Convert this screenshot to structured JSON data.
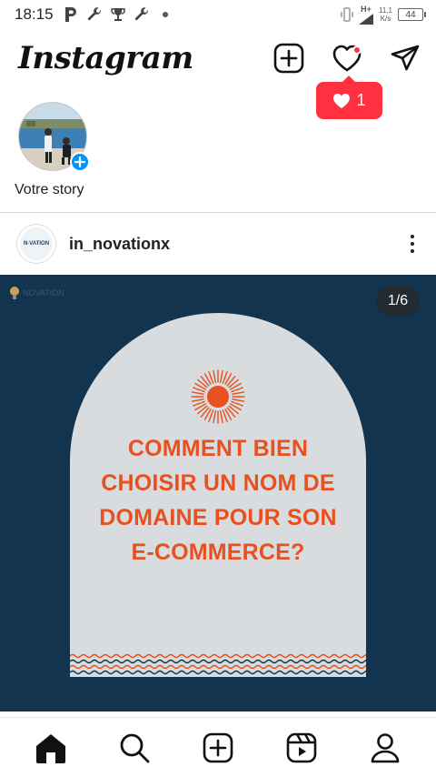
{
  "status_bar": {
    "time": "18:15",
    "icons": [
      "p-icon",
      "wrench-icon",
      "trophy-icon",
      "wrench-icon",
      "dot-icon"
    ],
    "network_type": "H+",
    "speed_value": "11,1",
    "speed_unit": "K/s",
    "battery": "44"
  },
  "header": {
    "logo": "Instagram",
    "actions": [
      "new-post-icon",
      "heart-icon",
      "direct-message-icon"
    ],
    "has_notification": true
  },
  "notification_bubble": {
    "icon": "heart-icon",
    "count": "1",
    "color": "#ff3040"
  },
  "stories": [
    {
      "label": "Votre story",
      "is_own": true
    }
  ],
  "post": {
    "username": "in_novationx",
    "avatar_text": "N·VATION",
    "counter": "1/6",
    "image": {
      "background": "#12344f",
      "arch_color": "#d8dcdf",
      "accent": "#e8501e",
      "brand_mark": "NOVATION",
      "headline_lines": [
        "COMMENT BIEN",
        "CHOISIR UN NOM DE",
        "DOMAINE POUR SON",
        "E-COMMERCE?"
      ]
    }
  },
  "bottom_nav": [
    "home-icon",
    "search-icon",
    "create-icon",
    "reels-icon",
    "profile-icon"
  ]
}
